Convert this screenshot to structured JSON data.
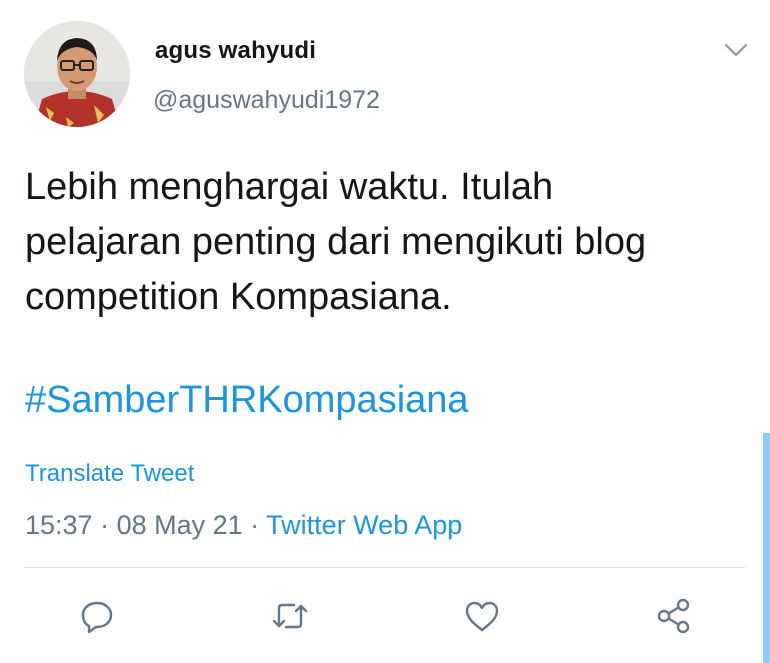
{
  "author": {
    "name": "agus wahyudi",
    "handle": "@aguswahyudi1972"
  },
  "tweet": {
    "text_lines": [
      "Lebih menghargai waktu. Itulah",
      "pelajaran penting dari mengikuti blog",
      "competition Kompasiana."
    ],
    "hashtag": "#SamberTHRKompasiana"
  },
  "translate_label": "Translate Tweet",
  "meta": {
    "time": "15:37",
    "separator": " · ",
    "date": "08 May 21",
    "source": "Twitter Web App"
  },
  "actions": {
    "reply_icon": "reply-icon",
    "retweet_icon": "retweet-icon",
    "like_icon": "like-icon",
    "share_icon": "share-icon"
  },
  "colors": {
    "link": "#1b95e0",
    "secondary_text": "#657786",
    "primary_text": "#14171a",
    "divider": "#e1e8ed"
  }
}
